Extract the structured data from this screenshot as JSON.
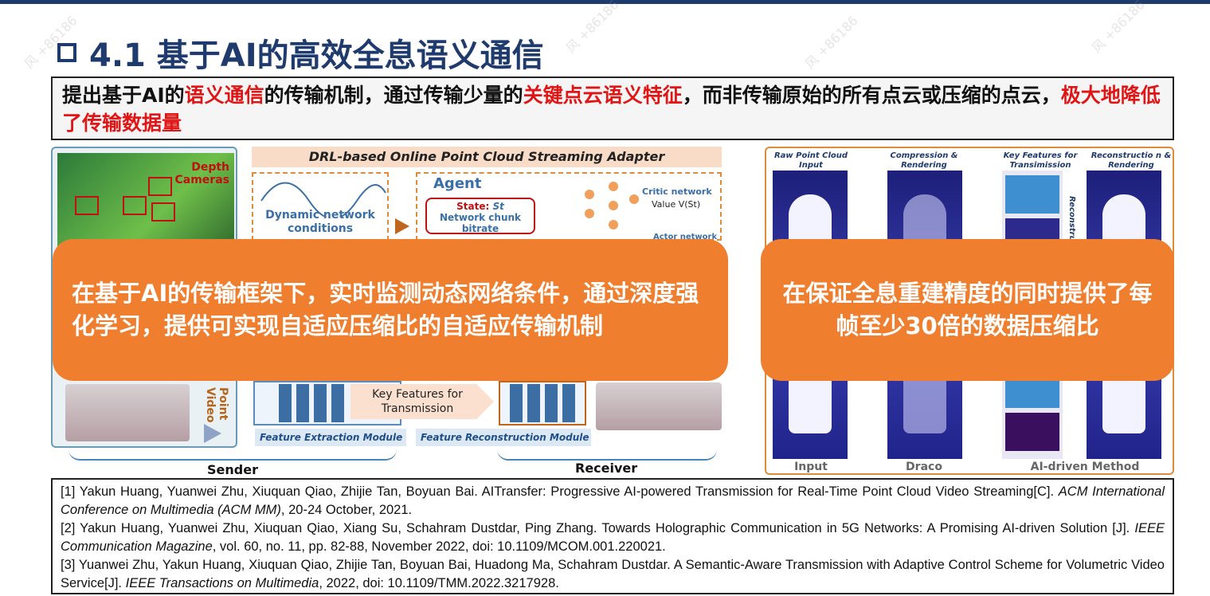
{
  "slide": {
    "title": "4.1 基于AI的高效全息语义通信",
    "intro": {
      "p1": "提出基于AI的",
      "r1": "语义通信",
      "p2": "的传输机制，通过传输少量的",
      "r2": "关键点云语义特征",
      "p3": "，而非传输原始的所有点云或压缩的点云，",
      "r3": "极大地降低了传输数据量"
    }
  },
  "figure_left": {
    "depth_cameras": "Depth Cameras",
    "point_video": "Point Video",
    "drl_header": "DRL-based Online Point Cloud Streaming Adapter",
    "dynamic_network": "Dynamic network conditions",
    "agent": "Agent",
    "state_label": "State:",
    "state_symbol": "St",
    "state_text": "Network chunk bitrate",
    "critic_network": "Critic network",
    "value": "Value V(St)",
    "actor_network": "Actor network",
    "key_features": "Key Features for Transmission",
    "feature_extraction": "Feature Extraction Module",
    "feature_reconstruction": "Feature Reconstruction Module",
    "sender": "Sender",
    "receiver": "Receiver"
  },
  "figure_right": {
    "col1": "Raw Point Cloud Input",
    "col2": "Compression & Rendering",
    "col3": "Key Features for Transimission",
    "col4": "Reconstructio n & Rendering",
    "reconstruction": "Reconstruction",
    "foot_input": "Input",
    "foot_draco": "Draco",
    "foot_ai": "AI-driven Method"
  },
  "callouts": {
    "left": "在基于AI的传输框架下，实时监测动态网络条件，通过深度强化学习，提供可实现自适应压缩比的自适应传输机制",
    "right": "在保证全息重建精度的同时提供了每帧至少30倍的数据压缩比"
  },
  "references": {
    "r1_a": "[1] Yakun Huang, Yuanwei Zhu, Xiuquan Qiao, Zhijie Tan, Boyuan Bai. AITransfer: Progressive AI-powered Transmission for Real-Time Point Cloud Video Streaming[C]. ",
    "r1_i": "ACM International Conference on Multimedia (ACM MM)",
    "r1_b": ", 20-24 October, 2021.",
    "r2_a": "[2] Yakun Huang, Yuanwei Zhu, Xiuquan Qiao, Xiang Su, Schahram Dustdar, Ping Zhang. Towards Holographic Communication in 5G Networks: A Promising AI-driven Solution [J]. ",
    "r2_i": "IEEE Communication Magazine",
    "r2_b": ", vol. 60, no. 11, pp. 82-88, November 2022, doi: 10.1109/MCOM.001.220021.",
    "r3_a": "[3] Yuanwei Zhu, Yakun Huang, Xiuquan Qiao, Zhijie Tan, Boyuan Bai, Huadong Ma, Schahram Dustdar. A Semantic-Aware Transmission with Adaptive Control Scheme for Volumetric Video Service[J]. ",
    "r3_i": "IEEE Transactions on Multimedia",
    "r3_b": ", 2022, doi: 10.1109/TMM.2022.3217928."
  },
  "watermark": "风 +86186"
}
